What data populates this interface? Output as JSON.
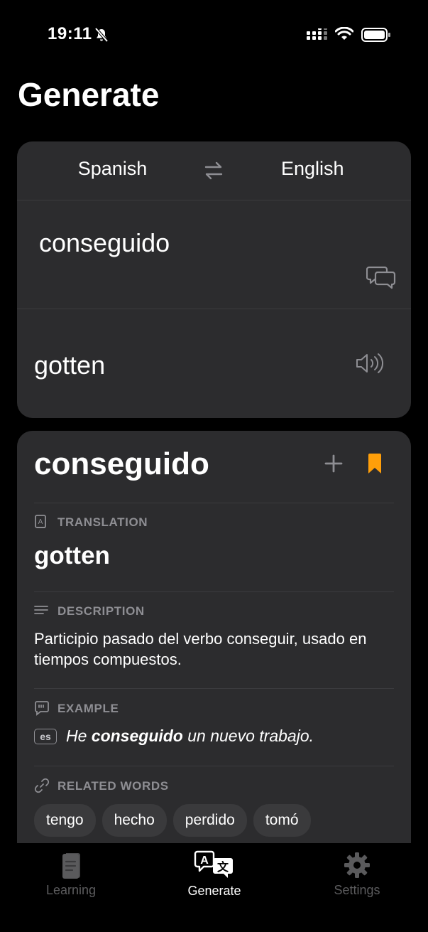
{
  "status": {
    "time": "19:11"
  },
  "header": {
    "title": "Generate"
  },
  "translator": {
    "source_lang": "Spanish",
    "target_lang": "English",
    "input_value": "conseguido",
    "output": "gotten"
  },
  "detail": {
    "word": "conseguido",
    "translation_label": "TRANSLATION",
    "translation": "gotten",
    "description_label": "DESCRIPTION",
    "description": "Participio pasado del verbo conseguir, usado en tiempos compuestos.",
    "example_label": "EXAMPLE",
    "example_lang": "es",
    "example_before": "He ",
    "example_word": "conseguido",
    "example_after": " un nuevo trabajo.",
    "related_label": "RELATED WORDS",
    "related": [
      "tengo",
      "hecho",
      "perdido",
      "tomó"
    ]
  },
  "tabs": [
    {
      "label": "Learning",
      "icon": "notebook-icon"
    },
    {
      "label": "Generate",
      "icon": "translate-icon"
    },
    {
      "label": "Settings",
      "icon": "gear-icon"
    }
  ],
  "colors": {
    "accent": "#ff9f0a",
    "card": "#2c2c2e",
    "muted": "#8e8e93"
  }
}
